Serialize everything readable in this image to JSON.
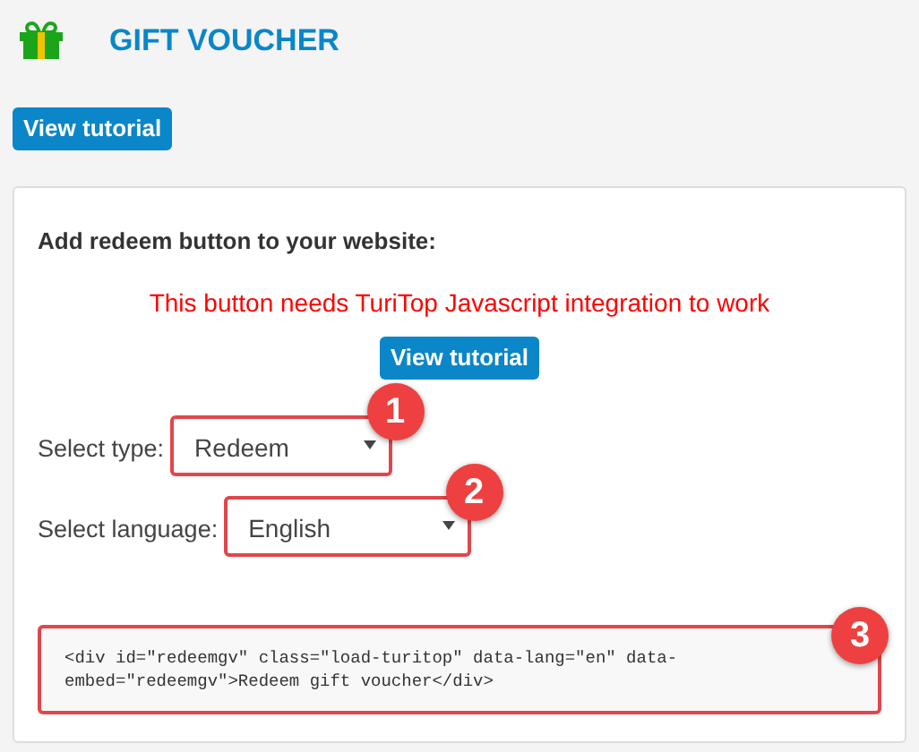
{
  "header": {
    "title": "GIFT VOUCHER"
  },
  "top_button": "View tutorial",
  "panel": {
    "heading": "Add redeem button to your website:",
    "warning": "This button needs TuriTop Javascript integration to work",
    "tutorial_button": "View tutorial",
    "fields": [
      {
        "label": "Select type:",
        "value": "Redeem",
        "callout": "1"
      },
      {
        "label": "Select language:",
        "value": "English",
        "callout": "2"
      }
    ],
    "code": {
      "lines": [
        "<div id=\"redeemgv\" class=\"load-turitop\" data-lang=\"en\" data-",
        "embed=\"redeemgv\">Redeem gift voucher</div>"
      ],
      "callout": "3"
    }
  }
}
